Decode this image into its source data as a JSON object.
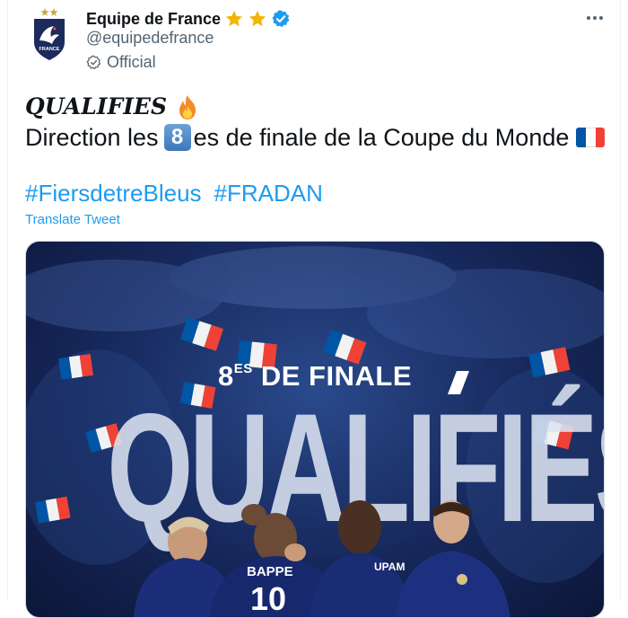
{
  "author": {
    "display_name": "Equipe de France",
    "handle": "@equipedefrance",
    "official_label": "Official",
    "badge_text": "FRANCE"
  },
  "tweet": {
    "line1": "QUALIFIES",
    "line2_prefix": "Direction les",
    "keycap_digit": "8",
    "line2_suffix": "es de finale de la Coupe du Monde",
    "hashtags": [
      "#FiersdetreBleus",
      "#FRADAN"
    ],
    "translate_label": "Translate Tweet"
  },
  "media": {
    "subtitle_main": "8",
    "subtitle_sup": "ES",
    "subtitle_rest": " DE FINALE",
    "big_word": "QUALIFIÉS",
    "jersey_name_1": "BAPPE",
    "jersey_number_1": "10",
    "jersey_name_2": "UPAM"
  },
  "colors": {
    "link": "#1d9bf0",
    "star": "#f4b400",
    "verified": "#1d9bf0",
    "muted": "#536471",
    "flag_blue": "#0055a4",
    "flag_red": "#ef4135"
  },
  "icons": {
    "fire": "fire-icon",
    "more": "more-icon",
    "verified": "verified-badge-icon",
    "official": "official-check-icon"
  }
}
